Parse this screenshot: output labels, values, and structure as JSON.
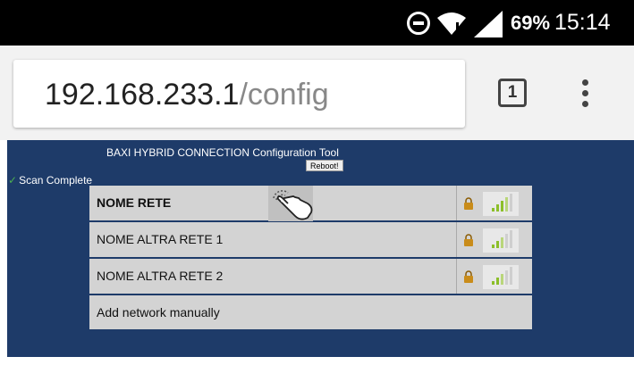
{
  "status_bar": {
    "battery": "69%",
    "time": "15:14"
  },
  "browser": {
    "url_host": "192.168.233.1",
    "url_path": "/config",
    "tab_count": "1"
  },
  "page": {
    "title": "BAXI HYBRID CONNECTION Configuration Tool",
    "reboot_label": "Reboot!",
    "scan_status": "Scan Complete",
    "networks": [
      {
        "name": "NOME RETE"
      },
      {
        "name": "NOME ALTRA RETE 1"
      },
      {
        "name": "NOME ALTRA RETE 2"
      }
    ],
    "add_network_label": "Add network manually"
  },
  "colors": {
    "page_background": "#1e3b69",
    "row_background": "#d3d3d3"
  }
}
